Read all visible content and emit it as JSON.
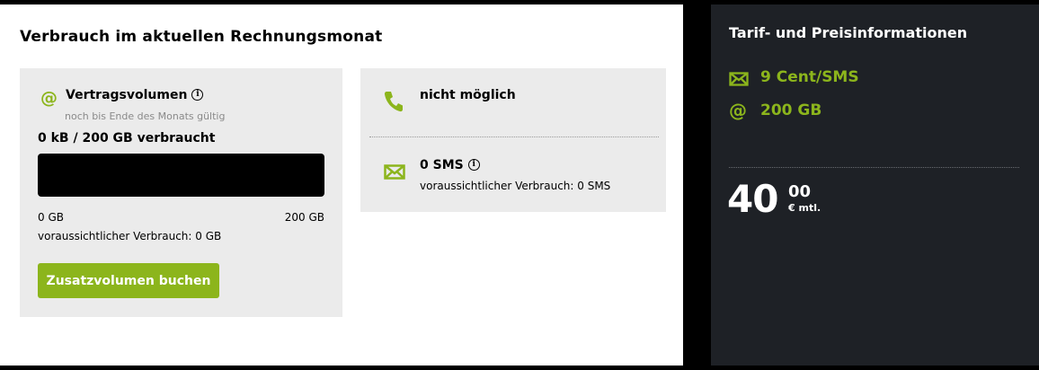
{
  "usage": {
    "title": "Verbrauch im aktuellen Rechnungsmonat",
    "data_volume": {
      "label": "Vertragsvolumen",
      "info_glyph": "i",
      "subtitle": "noch bis Ende des Monats gültig",
      "used_text": "0 kB / 200 GB verbraucht",
      "progress_fraction": 0,
      "axis_min_label": "0 GB",
      "axis_max_label": "200 GB",
      "forecast": "voraussichtlicher Verbrauch: 0 GB",
      "button_label": "Zusatzvolumen buchen",
      "icon": "at-icon"
    },
    "calls": {
      "label": "nicht möglich",
      "icon": "phone-icon"
    },
    "sms": {
      "label": "0 SMS",
      "info_glyph": "i",
      "forecast": "voraussichtlicher Verbrauch: 0 SMS",
      "icon": "envelope-icon"
    }
  },
  "tariff": {
    "title": "Tarif- und Preisinformationen",
    "items": [
      {
        "icon": "envelope-icon",
        "text": "9 Cent/SMS"
      },
      {
        "icon": "at-icon",
        "text": "200 GB"
      }
    ],
    "price": {
      "main": "40",
      "cents": "00",
      "unit": "€ mtl."
    }
  },
  "colors": {
    "accent": "#8cb51c",
    "dark_panel": "#1e2126",
    "card": "#ebebeb",
    "background": "#000000"
  }
}
